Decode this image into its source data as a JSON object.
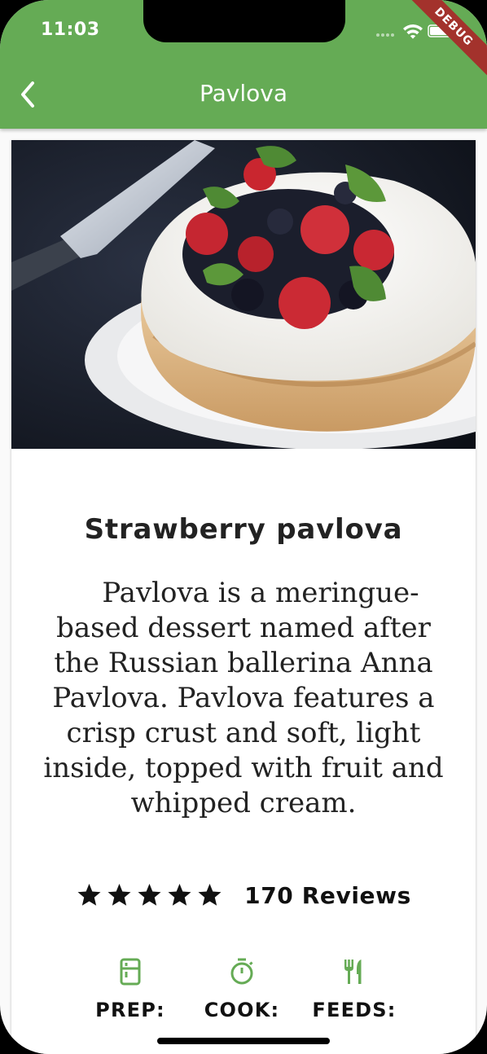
{
  "status_bar": {
    "time": "11:03"
  },
  "app_bar": {
    "title": "Pavlova",
    "debug_banner": "DEBUG"
  },
  "recipe": {
    "name": "Strawberry pavlova",
    "description": "Pavlova is a meringue-based dessert named after the Russian ballerina Anna Pavlova. Pavlova features a crisp crust and soft, light inside, topped with fruit and whipped cream.",
    "rating_stars": 5,
    "reviews": "170 Reviews"
  },
  "info": [
    {
      "label": "PREP:",
      "icon": "kitchen-icon"
    },
    {
      "label": "COOK:",
      "icon": "timer-icon"
    },
    {
      "label": "FEEDS:",
      "icon": "restaurant-icon"
    }
  ],
  "colors": {
    "app_bar": "#65ab55",
    "icon_green": "#65ab55",
    "debug": "#a3322c"
  }
}
